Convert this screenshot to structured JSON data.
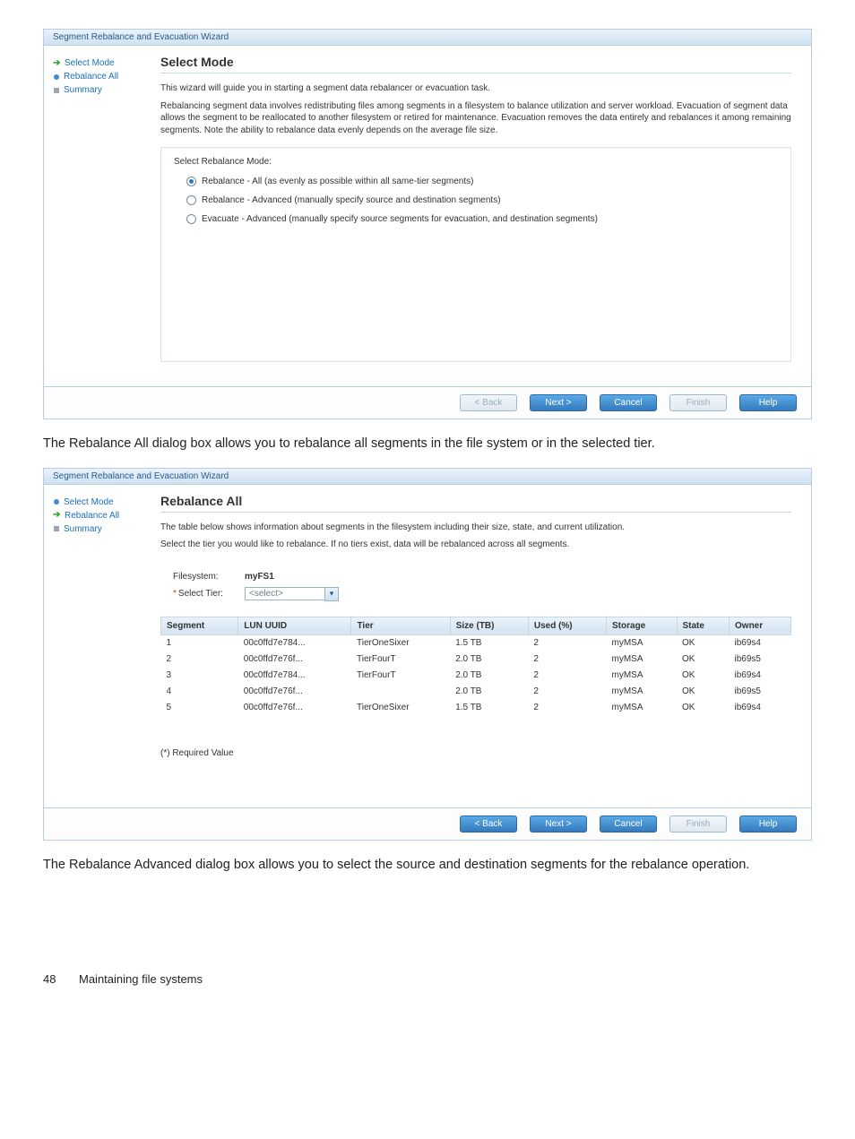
{
  "wizard1": {
    "title_bar": "Segment Rebalance and Evacuation Wizard",
    "sidebar": {
      "items": [
        {
          "label": "Select Mode",
          "icon": "arrow-green"
        },
        {
          "label": "Rebalance All",
          "icon": "dot-blue"
        },
        {
          "label": "Summary",
          "icon": "sq-grey"
        }
      ]
    },
    "main": {
      "heading": "Select Mode",
      "intro": "This wizard will guide you in starting a segment data rebalancer or evacuation task.",
      "desc": "Rebalancing segment data involves redistributing files among segments in a filesystem to balance utilization and server workload. Evacuation of segment data allows the segment to be reallocated to another filesystem or retired for maintenance. Evacuation removes the data entirely and rebalances it among remaining segments. Note the ability to rebalance data evenly depends on the average file size.",
      "prompt": "Select Rebalance Mode:",
      "options": [
        {
          "label": "Rebalance - All (as evenly as possible within all same-tier segments)",
          "selected": true
        },
        {
          "label": "Rebalance - Advanced (manually specify source and destination segments)",
          "selected": false
        },
        {
          "label": "Evacuate - Advanced (manually specify source segments for evacuation, and destination segments)",
          "selected": false
        }
      ]
    },
    "buttons": {
      "back": "< Back",
      "next": "Next >",
      "cancel": "Cancel",
      "finish": "Finish",
      "help": "Help"
    }
  },
  "body_para1": "The Rebalance All dialog box allows you to rebalance all segments in the file system or in the selected tier.",
  "wizard2": {
    "title_bar": "Segment Rebalance and Evacuation Wizard",
    "sidebar": {
      "items": [
        {
          "label": "Select Mode",
          "icon": "dot-blue"
        },
        {
          "label": "Rebalance All",
          "icon": "arrow-green"
        },
        {
          "label": "Summary",
          "icon": "sq-grey"
        }
      ]
    },
    "main": {
      "heading": "Rebalance All",
      "intro": "The table below shows information about segments in the filesystem including their size, state, and current utilization.",
      "desc2": "Select the tier you would like to rebalance. If no tiers exist, data will be rebalanced across all segments.",
      "fs_label": "Filesystem:",
      "fs_value": "myFS1",
      "tier_label": "Select Tier:",
      "tier_placeholder": "<select>",
      "columns": [
        "Segment",
        "LUN UUID",
        "Tier",
        "Size (TB)",
        "Used (%)",
        "Storage",
        "State",
        "Owner"
      ],
      "rows": [
        {
          "seg": "1",
          "lun": "00c0ffd7e784...",
          "tier": "TierOneSixer",
          "size": "1.5 TB",
          "used": "2",
          "storage": "myMSA",
          "state": "OK",
          "owner": "ib69s4"
        },
        {
          "seg": "2",
          "lun": "00c0ffd7e76f...",
          "tier": "TierFourT",
          "size": "2.0 TB",
          "used": "2",
          "storage": "myMSA",
          "state": "OK",
          "owner": "ib69s5"
        },
        {
          "seg": "3",
          "lun": "00c0ffd7e784...",
          "tier": "TierFourT",
          "size": "2.0 TB",
          "used": "2",
          "storage": "myMSA",
          "state": "OK",
          "owner": "ib69s4"
        },
        {
          "seg": "4",
          "lun": "00c0ffd7e76f...",
          "tier": "",
          "size": "2.0 TB",
          "used": "2",
          "storage": "myMSA",
          "state": "OK",
          "owner": "ib69s5"
        },
        {
          "seg": "5",
          "lun": "00c0ffd7e76f...",
          "tier": "TierOneSixer",
          "size": "1.5 TB",
          "used": "2",
          "storage": "myMSA",
          "state": "OK",
          "owner": "ib69s4"
        }
      ],
      "required_note": "(*) Required Value"
    },
    "buttons": {
      "back": "< Back",
      "next": "Next >",
      "cancel": "Cancel",
      "finish": "Finish",
      "help": "Help"
    }
  },
  "body_para2": "The Rebalance Advanced dialog box allows you to select the source and destination segments for the rebalance operation.",
  "footer": {
    "page": "48",
    "section": "Maintaining file systems"
  }
}
